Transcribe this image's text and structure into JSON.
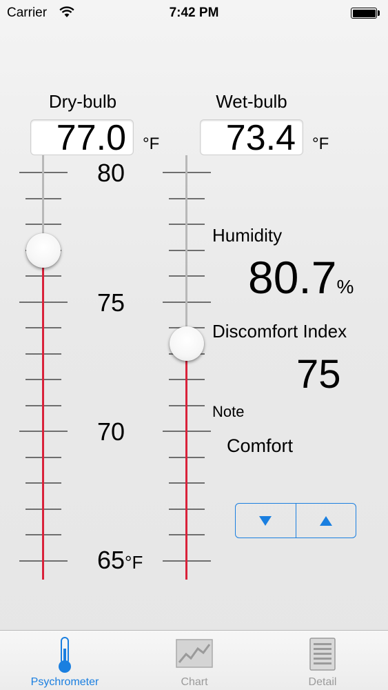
{
  "status_bar": {
    "carrier": "Carrier",
    "time": "7:42 PM",
    "icons": [
      "wifi-icon",
      "battery-icon"
    ]
  },
  "dry_bulb": {
    "title": "Dry-bulb",
    "value": "77.0",
    "unit": "°F",
    "scale_labels": [
      "80",
      "75",
      "70",
      "65"
    ],
    "scale_unit": "°F",
    "scale_min": 65,
    "scale_max": 80,
    "slider_value": 77.0
  },
  "wet_bulb": {
    "title": "Wet-bulb",
    "value": "73.4",
    "unit": "°F",
    "scale_min": 65,
    "scale_max": 80,
    "slider_value": 73.4
  },
  "results": {
    "humidity_label": "Humidity",
    "humidity_value": "80.7",
    "humidity_unit": "%",
    "discomfort_label": "Discomfort Index",
    "discomfort_value": "75",
    "note_label": "Note",
    "note_value": "Comfort"
  },
  "stepper": {
    "down_icon": "down-triangle-icon",
    "up_icon": "up-triangle-icon"
  },
  "tab_bar": {
    "active_color": "#1a7fe0",
    "inactive_color": "#9a9a9a",
    "tabs": [
      {
        "label": "Psychrometer",
        "icon": "thermometer-icon",
        "active": true
      },
      {
        "label": "Chart",
        "icon": "chart-icon",
        "active": false
      },
      {
        "label": "Detail",
        "icon": "document-icon",
        "active": false
      }
    ]
  },
  "colors": {
    "mercury_red": "#d9223a",
    "accent_blue": "#1a7fe0"
  }
}
